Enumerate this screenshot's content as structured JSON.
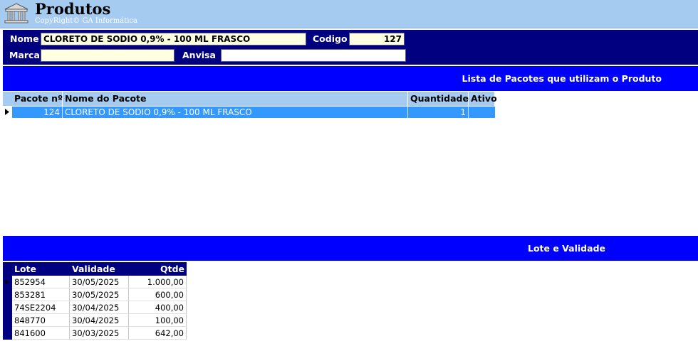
{
  "app": {
    "title": "Produtos",
    "copyright": "CopyRight© GA Informática"
  },
  "form": {
    "nome_label": "Nome",
    "nome_value": "CLORETO DE SODIO 0,9% - 100 ML FRASCO",
    "codigo_label": "Codigo",
    "codigo_value": "127",
    "marca_label": "Marca",
    "marca_value": "",
    "anvisa_label": "Anvisa",
    "anvisa_value": ""
  },
  "pacotes": {
    "section_title": "Lista de Pacotes que utilizam o Produto",
    "columns": [
      "Pacote nº",
      "Nome do Pacote",
      "Quantidade",
      "Ativo"
    ],
    "rows": [
      {
        "pacote": "124",
        "nome": "CLORETO DE SODIO 0,9% - 100 ML FRASCO",
        "quantidade": "1",
        "ativo": ""
      }
    ]
  },
  "lotes": {
    "section_title": "Lote e Validade",
    "columns": [
      "Lote",
      "Validade",
      "Qtde"
    ],
    "rows": [
      {
        "lote": "852954",
        "validade": "30/05/2025",
        "qtde": "1.000,00"
      },
      {
        "lote": "853281",
        "validade": "30/05/2025",
        "qtde": "600,00"
      },
      {
        "lote": "74SE2204",
        "validade": "30/04/2025",
        "qtde": "400,00"
      },
      {
        "lote": "848770",
        "validade": "30/04/2025",
        "qtde": "100,00"
      },
      {
        "lote": "841600",
        "validade": "30/03/2025",
        "qtde": "642,00"
      }
    ]
  },
  "colors": {
    "titlebar": "#a6cbf0",
    "navy": "#000080",
    "band_blue": "#0000ff",
    "selected_row": "#3399ff",
    "field_yellow": "#ffffe1"
  }
}
